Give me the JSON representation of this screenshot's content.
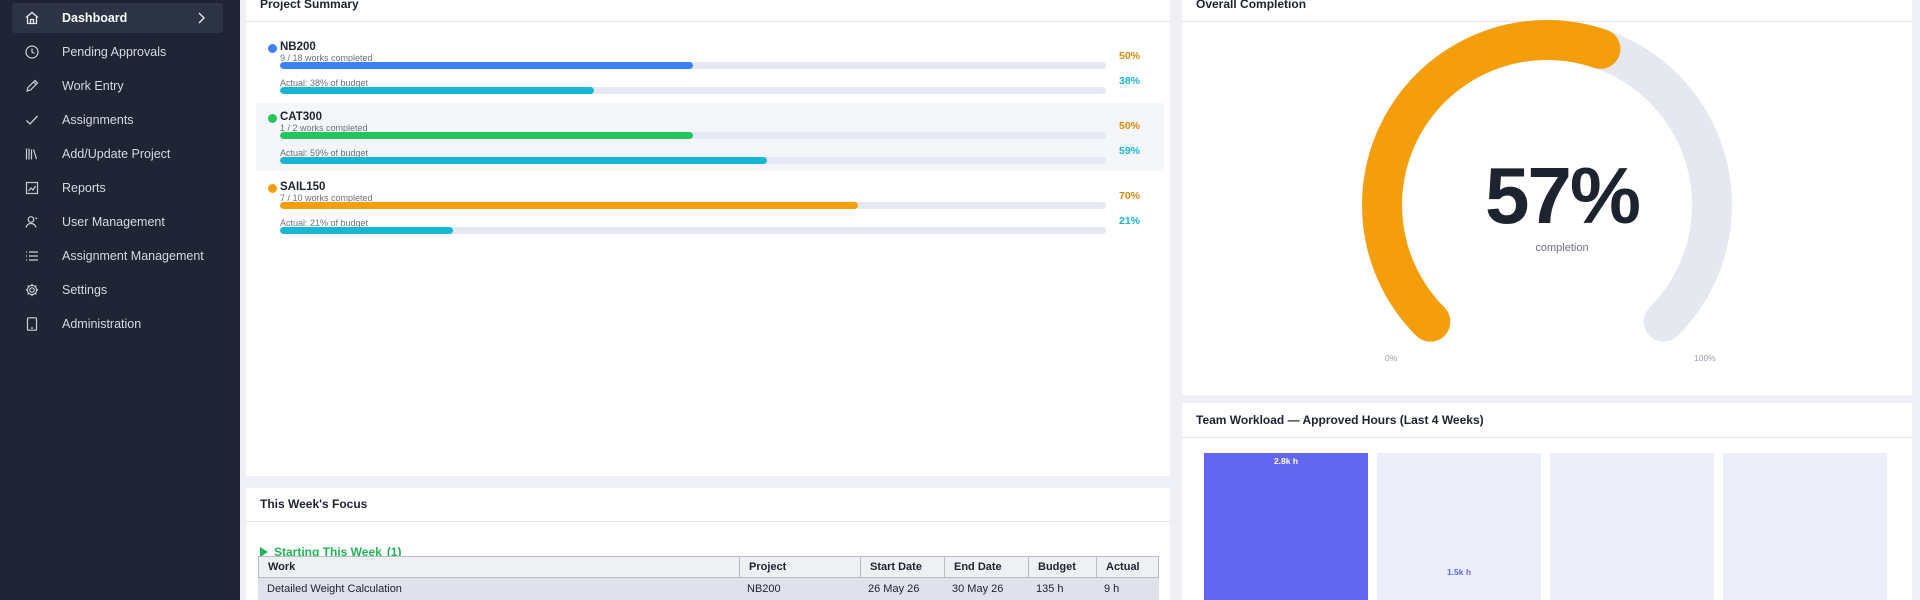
{
  "sidebar": {
    "items": [
      {
        "label": "Dashboard",
        "icon": "home-icon",
        "active": true
      },
      {
        "label": "Pending Approvals",
        "icon": "clock-icon"
      },
      {
        "label": "Work Entry",
        "icon": "pencil-icon"
      },
      {
        "label": "Assignments",
        "icon": "check-icon"
      },
      {
        "label": "Add/Update Project",
        "icon": "books-icon"
      },
      {
        "label": "Reports",
        "icon": "chart-icon"
      },
      {
        "label": "User Management",
        "icon": "user-icon"
      },
      {
        "label": "Assignment Management",
        "icon": "list-icon"
      },
      {
        "label": "Settings",
        "icon": "gear-icon"
      },
      {
        "label": "Administration",
        "icon": "tablet-icon"
      }
    ]
  },
  "project_summary": {
    "title": "Project Summary",
    "projects": [
      {
        "name": "NB200",
        "color": "#3b82f6",
        "works_text": "9 / 18 works completed",
        "works_fraction": 0.5,
        "works_pct": "50%",
        "works_color": "#3b82f6",
        "budget_text": "Actual: 38% of budget",
        "budget_fraction": 0.38,
        "budget_pct": "38%"
      },
      {
        "name": "CAT300",
        "color": "#22c55e",
        "works_text": "1 / 2 works completed",
        "works_fraction": 0.5,
        "works_pct": "50%",
        "works_color": "#22c55e",
        "budget_text": "Actual: 59% of budget",
        "budget_fraction": 0.59,
        "budget_pct": "59%"
      },
      {
        "name": "SAIL150",
        "color": "#f59e0b",
        "works_text": "7 / 10 works completed",
        "works_fraction": 0.7,
        "works_pct": "70%",
        "works_color": "#f59e0b",
        "budget_text": "Actual: 21% of budget",
        "budget_fraction": 0.21,
        "budget_pct": "21%"
      }
    ],
    "works_pct_color": "#d68a0c",
    "budget_color": "#16b6d4"
  },
  "overall_completion": {
    "title": "Overall Completion",
    "value_text": "57%",
    "fraction": 0.57,
    "caption": "completion",
    "min_label": "0%",
    "max_label": "100%",
    "fill_color": "#f59e0b",
    "track_color": "#e5e8ef"
  },
  "focus": {
    "title": "This Week's Focus",
    "section_label": "Starting This Week",
    "section_count": "(1)",
    "columns": [
      "Work",
      "Project",
      "Start Date",
      "End Date",
      "Budget",
      "Actual"
    ],
    "rows": [
      [
        "Detailed Weight Calculation",
        "NB200",
        "26 May 26",
        "30 May 26",
        "135 h",
        "9 h"
      ]
    ]
  },
  "workload": {
    "title": "Team Workload — Approved Hours (Last 4 Weeks)",
    "bars": [
      {
        "label": "2.8k h",
        "value": 2800,
        "highlight": true
      },
      {
        "label": "1.5k h",
        "value": 1500,
        "highlight": false
      },
      {
        "label": "",
        "value": null,
        "highlight": false
      },
      {
        "label": "",
        "value": null,
        "highlight": false
      }
    ],
    "bar_color": "#6366f1",
    "muted_color": "#eceefa"
  }
}
